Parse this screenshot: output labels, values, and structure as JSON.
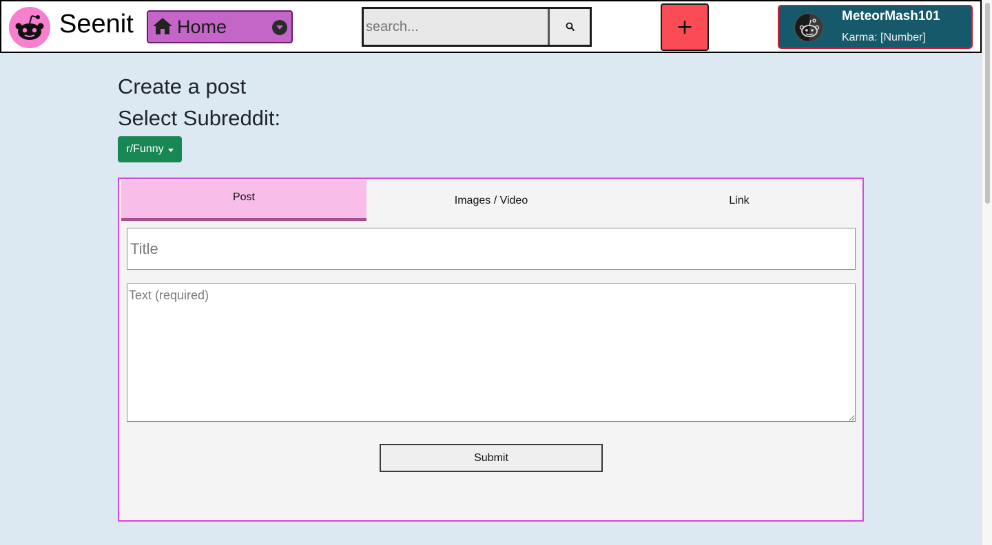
{
  "header": {
    "brand": "Seenit",
    "home_label": "Home",
    "search_placeholder": "search...",
    "create_label": "+",
    "user": {
      "name": "MeteorMash101",
      "karma": "Karma: [Number]"
    }
  },
  "main": {
    "title": "Create a post",
    "select_label": "Select Subreddit:",
    "subreddit_selected": "r/Funny",
    "tabs": [
      {
        "label": "Post",
        "active": true
      },
      {
        "label": "Images / Video",
        "active": false
      },
      {
        "label": "Link",
        "active": false
      }
    ],
    "title_placeholder": "Title",
    "text_placeholder": "Text (required)",
    "submit_label": "Submit"
  },
  "colors": {
    "background": "#dce9f3",
    "home_dropdown": "#c466c8",
    "create_button": "#fb4b55",
    "user_card": "#15596b",
    "subreddit_button": "#198754",
    "active_tab": "#f8bde9",
    "card_border": "#d946e0",
    "logo": "#f77fce"
  },
  "icons": {
    "logo": "reddit-alien-icon",
    "home": "house-icon",
    "dropdown": "chevron-down-icon",
    "search": "search-icon",
    "avatar": "reddit-avatar-icon"
  }
}
